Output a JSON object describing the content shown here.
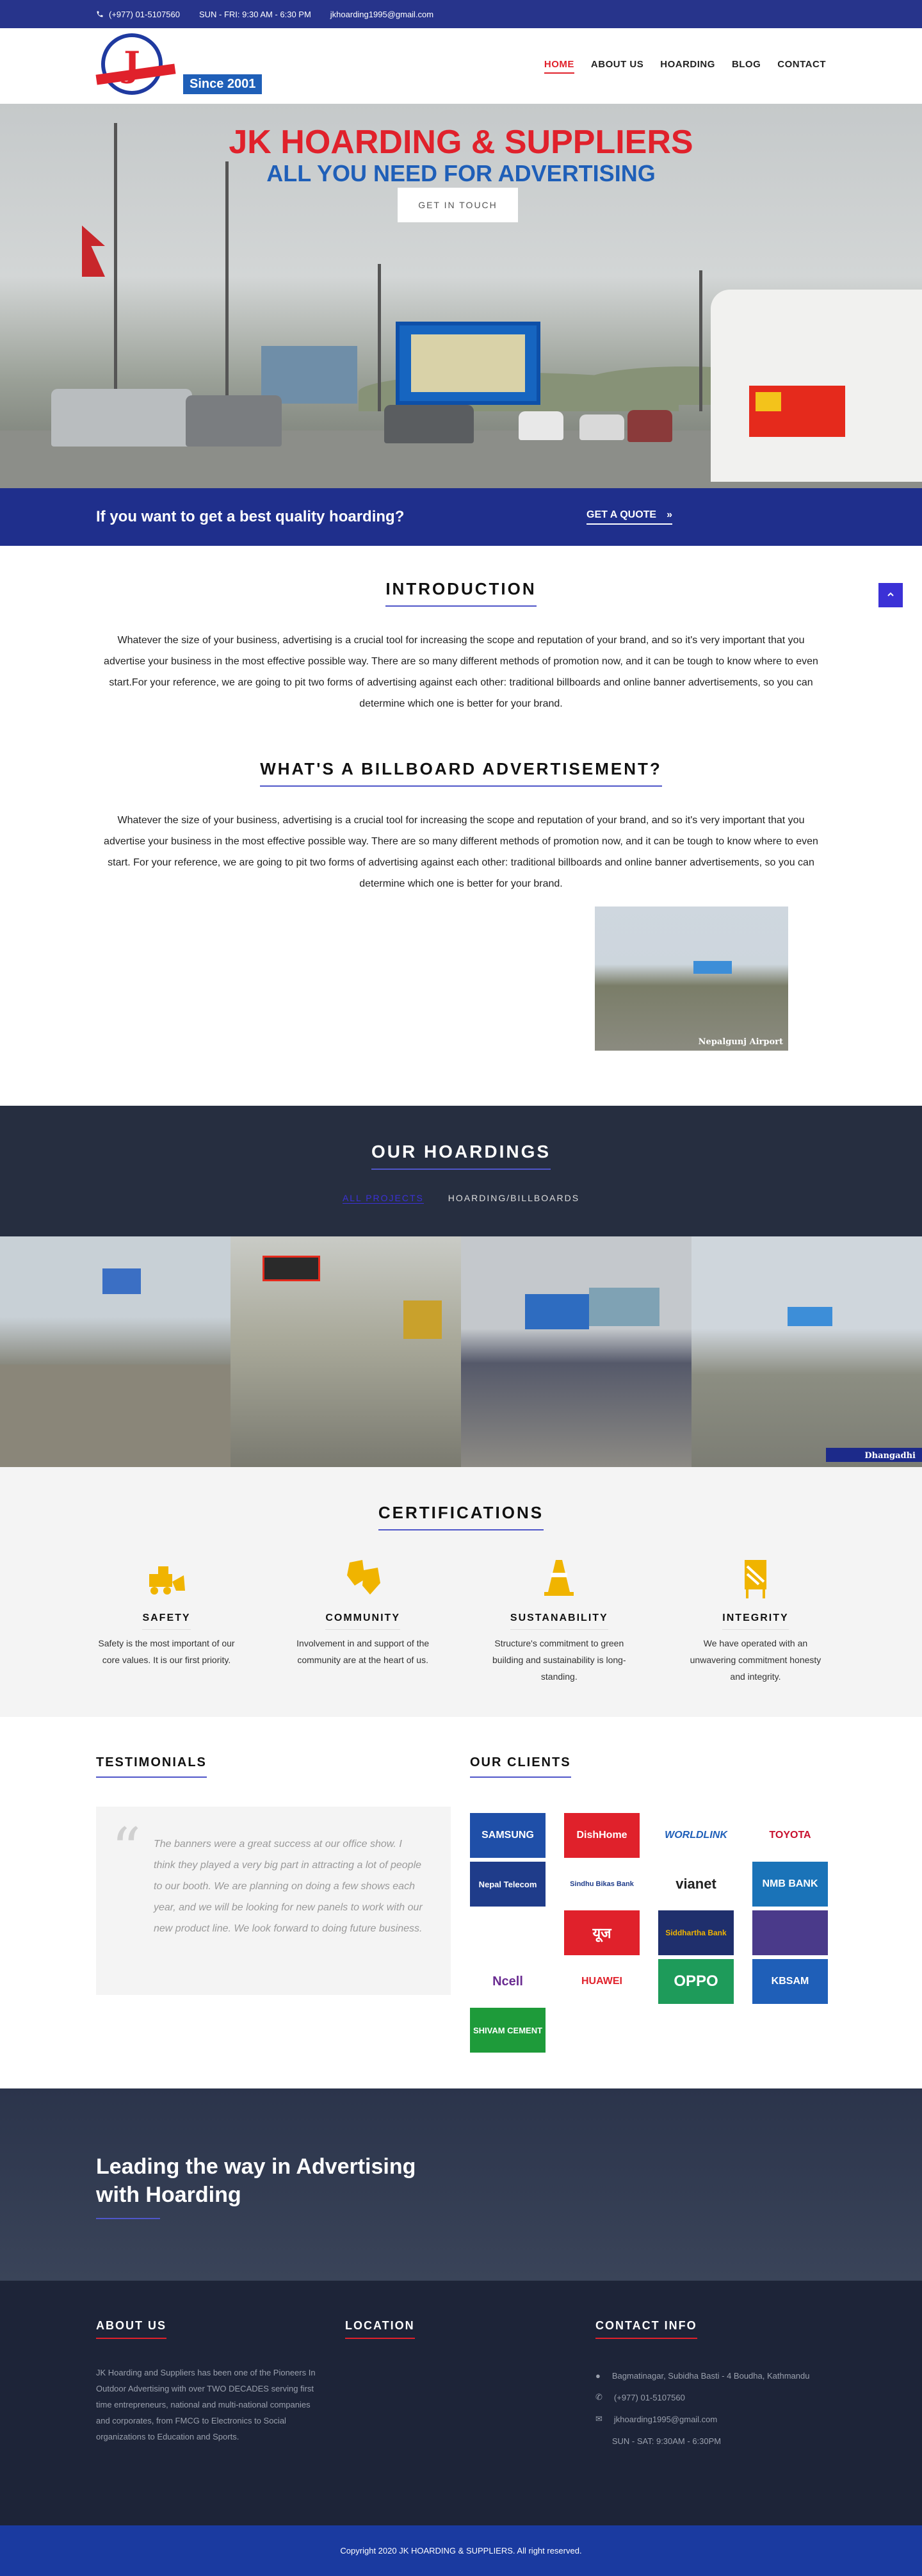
{
  "topbar": {
    "phone": "(+977) 01-5107560",
    "hours": "SUN - FRI: 9:30 AM - 6:30 PM",
    "email": "jkhoarding1995@gmail.com"
  },
  "header": {
    "since": "Since 2001",
    "nav": [
      "HOME",
      "ABOUT US",
      "HOARDING",
      "BLOG",
      "CONTACT"
    ],
    "active": "HOME"
  },
  "hero": {
    "title": "JK HOARDING & SUPPLIERS",
    "subtitle": "ALL YOU NEED FOR ADVERTISING",
    "button": "GET IN TOUCH"
  },
  "cta": {
    "text": "If you want to get a best quality hoarding?",
    "button": "GET A QUOTE",
    "arrow": "»"
  },
  "intro": {
    "title": "INTRODUCTION",
    "body": "Whatever the size of your business, advertising is a crucial tool for increasing the scope and reputation of your brand, and so it's very important that you advertise your business in the most effective possible way. There are so many different methods of promotion now, and it can be tough to know where to even start.For your reference, we are going to pit two forms of advertising against each other: traditional billboards and online banner advertisements, so you can determine which one is better for your brand."
  },
  "billboard": {
    "title": "WHAT'S A BILLBOARD ADVERTISEMENT?",
    "body": "Whatever the size of your business, advertising is a crucial tool for increasing the scope and reputation of your brand, and so it's very important that you advertise your business in the most effective possible way. There are so many different methods of promotion now, and it can be tough to know where to even start. For your reference, we are going to pit two forms of advertising against each  other: traditional billboards and online banner advertisements, so you can determine which one is better for your brand.",
    "photo_caption": "Nepalgunj Airport"
  },
  "hoardings": {
    "title": "OUR HOARDINGS",
    "filters": [
      "ALL PROJECTS",
      "HOARDING/BILLBOARDS"
    ],
    "last_caption": "Dhangadhi"
  },
  "certifications": {
    "title": "CERTIFICATIONS",
    "items": [
      {
        "name": "SAFETY",
        "desc": "Safety is the most important of our core values. It is our first priority.",
        "icon": "bulldozer-icon"
      },
      {
        "name": "COMMUNITY",
        "desc": "Involvement in and support of the community are at the heart of us.",
        "icon": "gloves-icon"
      },
      {
        "name": "SUSTANABILITY",
        "desc": "Structure's commitment to green building and sustainability is long-standing.",
        "icon": "traffic-cone-icon"
      },
      {
        "name": "INTEGRITY",
        "desc": "We have operated with an unwavering commitment honesty and integrity.",
        "icon": "barrier-icon"
      }
    ]
  },
  "testimonials": {
    "title": "TESTIMONIALS",
    "quote": "The banners were a great success at our office show. I think they played a very big part in attracting a lot of people to our booth. We are planning on doing a few shows each year, and we will be looking for new panels to work with our new product line. We look forward to doing future business."
  },
  "clients": {
    "title": "OUR CLIENTS",
    "logos": [
      "SAMSUNG",
      "DishHome",
      "WORLDLINK",
      "TOYOTA",
      "Nepal Telecom",
      "Sindhu Bikas Bank",
      "vianet",
      "NMB BANK",
      "",
      "यूज",
      "Siddhartha Bank",
      "",
      "Ncell",
      "HUAWEI",
      "OPPO",
      "KBSAM",
      "SHIVAM CEMENT"
    ]
  },
  "lead": {
    "line1": "Leading the way in Advertising",
    "line2": "with Hoarding"
  },
  "footer": {
    "about_title": "ABOUT US",
    "about_text": "JK Hoarding and Suppliers has been one of the Pioneers In Outdoor Advertising with over TWO DECADES serving first time entrepreneurs, national and multi-national companies and corporates, from FMCG to Electronics to Social organizations to Education and Sports.",
    "location_title": "LOCATION",
    "contact_title": "CONTACT INFO",
    "address": "Bagmatinagar, Subidha Basti - 4 Boudha, Kathmandu",
    "phone": "(+977) 01-5107560",
    "email": "jkhoarding1995@gmail.com",
    "hours": "SUN - SAT: 9:30AM - 6:30PM",
    "copyright": "Copyright 2020 JK HOARDING & SUPPLIERS. All right reserved."
  },
  "colors": {
    "brand_blue": "#27348b",
    "brand_red": "#e0212b",
    "accent": "#3b31d6",
    "icon_yellow": "#f0b400"
  }
}
